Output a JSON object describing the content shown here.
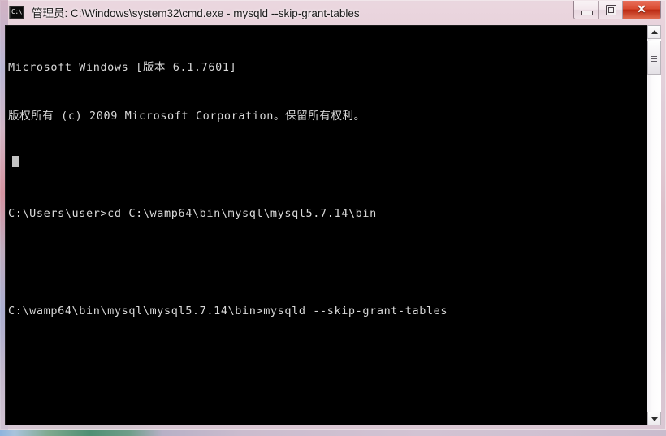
{
  "window": {
    "title": "管理员: C:\\Windows\\system32\\cmd.exe - mysqld  --skip-grant-tables",
    "icon_label": "C:\\",
    "icon_name": "cmd-exe-icon"
  },
  "titlebar_buttons": {
    "minimize_label": "",
    "maximize_label": "",
    "close_label": "✕"
  },
  "console": {
    "background_color": "#000000",
    "text_color": "#d9d9d9",
    "lines": [
      "Microsoft Windows [版本 6.1.7601]",
      "版权所有 (c) 2009 Microsoft Corporation。保留所有权利。",
      "",
      "C:\\Users\\user>cd C:\\wamp64\\bin\\mysql\\mysql5.7.14\\bin",
      "",
      "C:\\wamp64\\bin\\mysql\\mysql5.7.14\\bin>mysqld --skip-grant-tables"
    ],
    "cursor_visible": true
  },
  "scrollbar": {
    "up_arrow": "▲",
    "down_arrow": "▼",
    "thumb_position_percent": 4
  },
  "theme": {
    "titlebar_color": "#dfc7d2",
    "close_button_color": "#d94a30",
    "frame_border_color": "#c9bccd"
  }
}
